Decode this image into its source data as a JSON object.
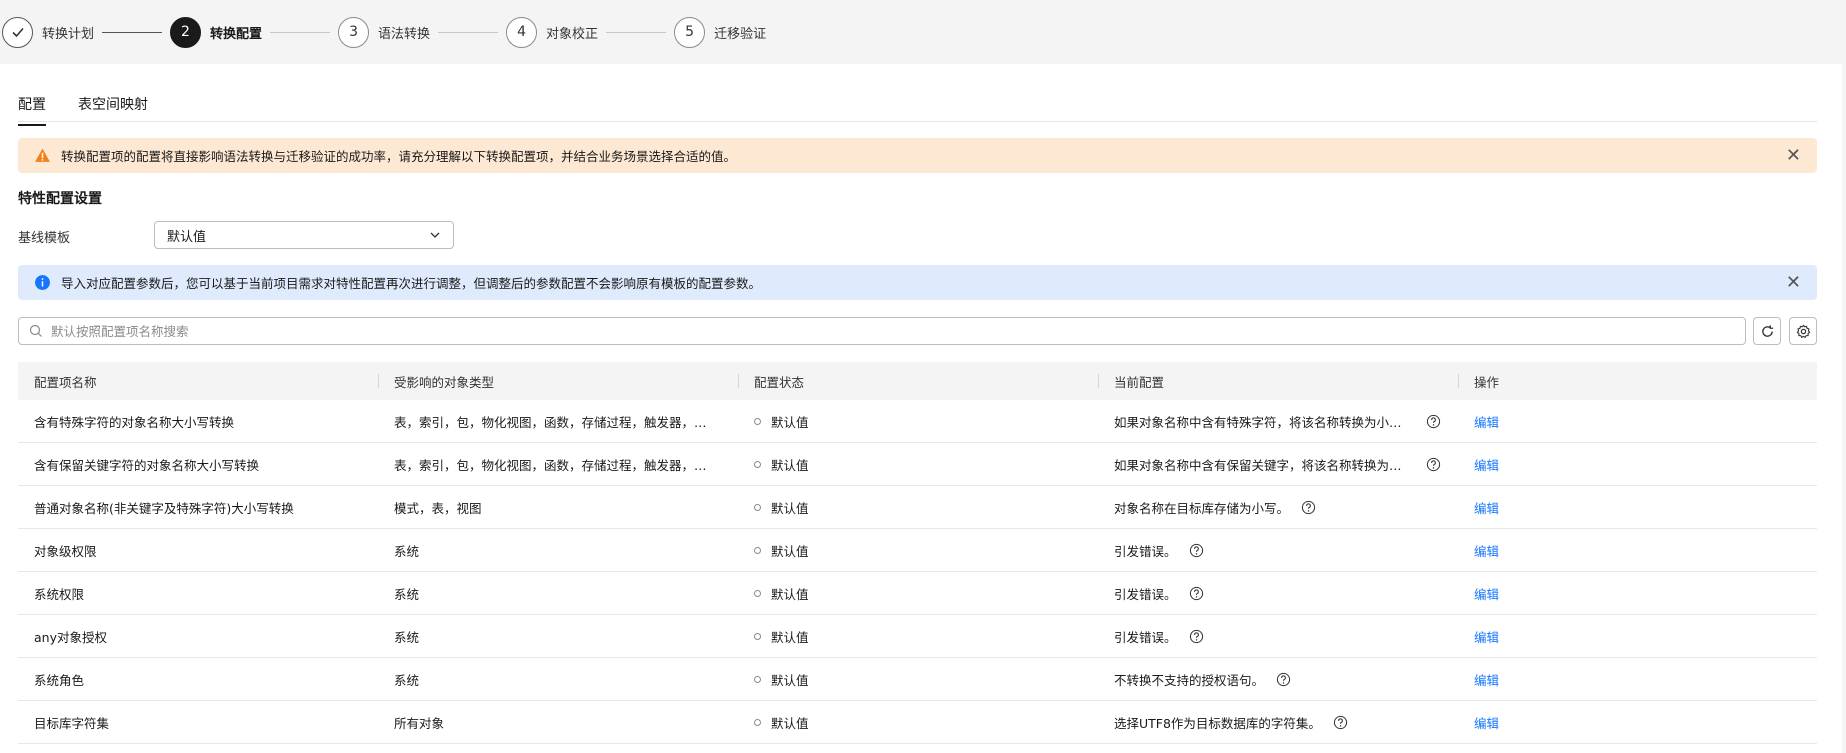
{
  "steps": [
    {
      "num": "",
      "label": "转换计划",
      "state": "done"
    },
    {
      "num": "2",
      "label": "转换配置",
      "state": "active"
    },
    {
      "num": "3",
      "label": "语法转换",
      "state": "todo"
    },
    {
      "num": "4",
      "label": "对象校正",
      "state": "todo"
    },
    {
      "num": "5",
      "label": "迁移验证",
      "state": "todo"
    }
  ],
  "tabs": [
    {
      "label": "配置",
      "active": true
    },
    {
      "label": "表空间映射",
      "active": false
    }
  ],
  "warning_alert": {
    "text": "转换配置项的配置将直接影响语法转换与迁移验证的成功率，请充分理解以下转换配置项，并结合业务场景选择合适的值。"
  },
  "section_title": "特性配置设置",
  "baseline": {
    "label": "基线模板",
    "value": "默认值"
  },
  "info_alert": {
    "text": "导入对应配置参数后，您可以基于当前项目需求对特性配置再次进行调整，但调整后的参数配置不会影响原有模板的配置参数。"
  },
  "search": {
    "placeholder": "默认按照配置项名称搜索"
  },
  "table": {
    "headers": [
      "配置项名称",
      "受影响的对象类型",
      "配置状态",
      "当前配置",
      "操作"
    ],
    "rows": [
      {
        "name": "含有特殊字符的对象名称大小写转换",
        "types": "表，索引，包，物化视图，函数，存储过程，触发器，用户...",
        "status": "默认值",
        "config": "如果对象名称中含有特殊字符，将该名称转换为小写字...",
        "action": "编辑"
      },
      {
        "name": "含有保留关键字符的对象名称大小写转换",
        "types": "表，索引，包，物化视图，函数，存储过程，触发器，用户...",
        "status": "默认值",
        "config": "如果对象名称中含有保留关键字，将该名称转换为小写...",
        "action": "编辑"
      },
      {
        "name": "普通对象名称(非关键字及特殊字符)大小写转换",
        "types": "模式，表，视图",
        "status": "默认值",
        "config": "对象名称在目标库存储为小写。",
        "action": "编辑"
      },
      {
        "name": "对象级权限",
        "types": "系统",
        "status": "默认值",
        "config": "引发错误。",
        "action": "编辑"
      },
      {
        "name": "系统权限",
        "types": "系统",
        "status": "默认值",
        "config": "引发错误。",
        "action": "编辑"
      },
      {
        "name": "any对象授权",
        "types": "系统",
        "status": "默认值",
        "config": "引发错误。",
        "action": "编辑"
      },
      {
        "name": "系统角色",
        "types": "系统",
        "status": "默认值",
        "config": "不转换不支持的授权语句。",
        "action": "编辑"
      },
      {
        "name": "目标库字符集",
        "types": "所有对象",
        "status": "默认值",
        "config": "选择UTF8作为目标数据库的字符集。",
        "action": "编辑"
      }
    ]
  },
  "colors": {
    "warn_bg": "#fde9d3",
    "info_bg": "#dfeafd",
    "link": "#1476ff",
    "active_step": "#1a1a1a"
  }
}
